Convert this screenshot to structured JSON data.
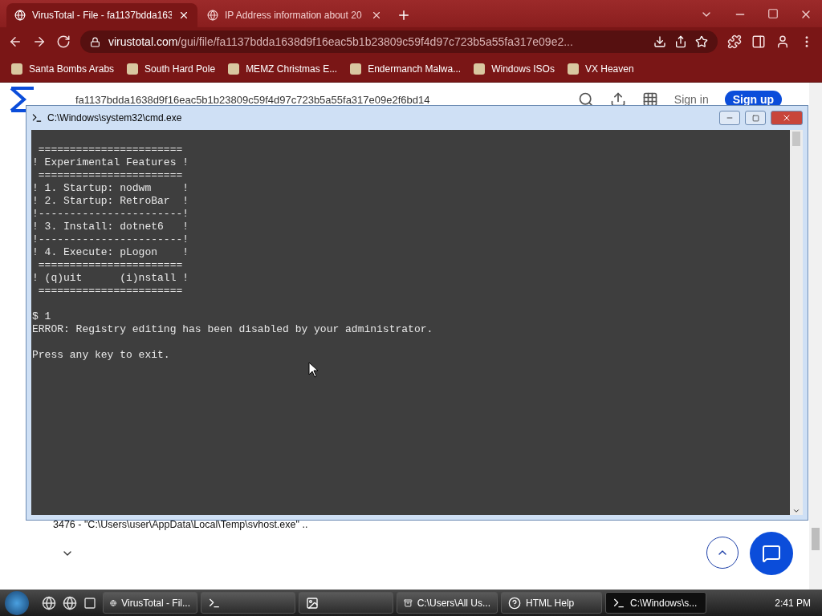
{
  "browser": {
    "tabs": [
      {
        "title": "VirusTotal - File - fa1137bdda163",
        "selected": true
      },
      {
        "title": "IP Address information about 20",
        "selected": false
      }
    ],
    "address": {
      "host": "virustotal.com",
      "path": "/gui/file/fa1137bdda1638d9f16eac5b1b23809c59f4d97c723b5a55fa317e09e2..."
    },
    "bookmarks": [
      "Santa Bombs Arabs",
      "South Hard Pole",
      "MEMZ Christmas E...",
      "Endermanch Malwa...",
      "Windows ISOs",
      "VX Heaven"
    ]
  },
  "site": {
    "hash": "fa1137bdda1638d9f16eac5b1b23809c59f4d97c723b5a55fa317e09e2f6bd14",
    "sign_in": "Sign in",
    "sign_up": "Sign up",
    "processes": [
      {
        "text": "3476 - \"C:\\Users\\user\\AppData\\Local\\Temp\\svhost.exe\" .."
      }
    ]
  },
  "console": {
    "title": "C:\\Windows\\system32\\cmd.exe",
    "output": " =======================\n! Experimental Features !\n =======================\n! 1. Startup: nodwm     !\n! 2. Startup: RetroBar  !\n!-----------------------!\n! 3. Install: dotnet6   !\n!-----------------------!\n! 4. Execute: pLogon    !\n =======================\n! (q)uit      (i)nstall !\n =======================\n\n$ 1\nERROR: Registry editing has been disabled by your administrator.\n\nPress any key to exit."
  },
  "taskbar": {
    "buttons": [
      {
        "kind": "browser",
        "label": "VirusTotal - Fil...",
        "selected": false
      },
      {
        "kind": "console",
        "selected": false
      },
      {
        "kind": "image",
        "selected": false
      },
      {
        "kind": "archive",
        "label": "C:\\Users\\All Us...",
        "selected": false
      },
      {
        "kind": "help",
        "label": "HTML Help",
        "selected": false
      },
      {
        "kind": "console",
        "label": "C:\\Windows\\s...",
        "selected": true
      }
    ],
    "clock": "2:41 PM"
  }
}
